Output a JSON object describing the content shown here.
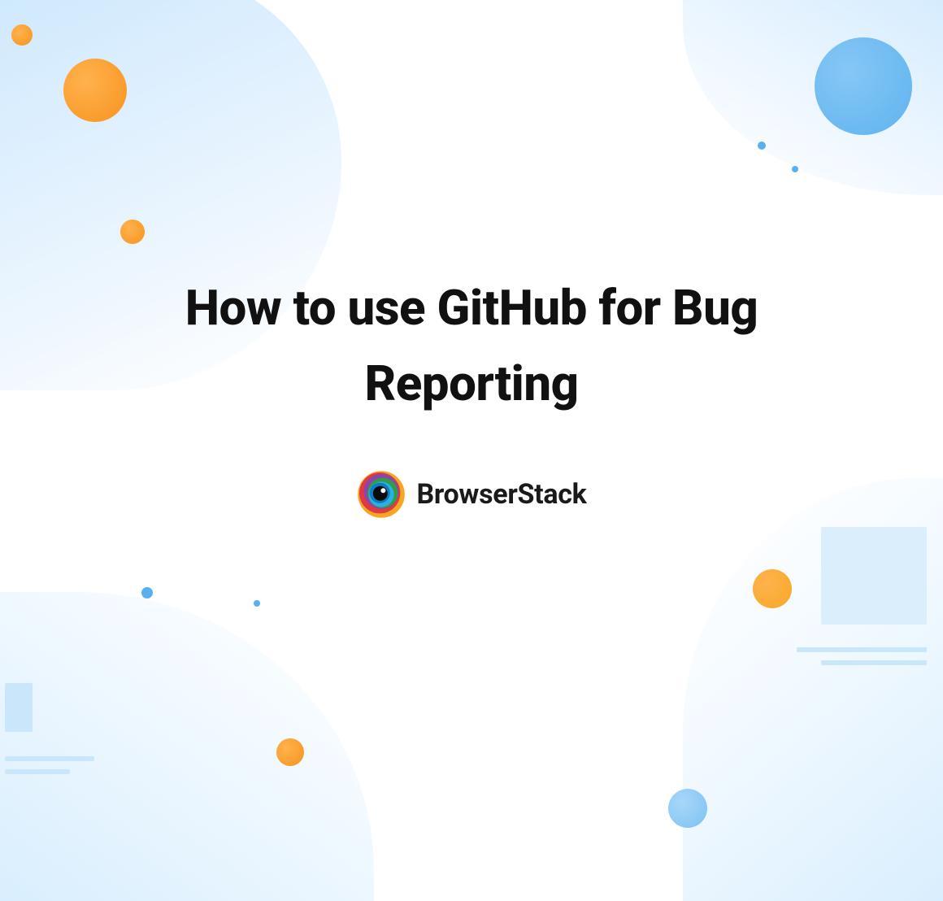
{
  "hero": {
    "title": "How to use GitHub for Bug Reporting"
  },
  "brand": {
    "name": "BrowserStack",
    "logo_icon": "browserstack-logo"
  },
  "palette": {
    "orange": "#f7931e",
    "blue_light": "#cbe7fd",
    "blue_dot": "#5ab0ee",
    "text": "#111111"
  }
}
